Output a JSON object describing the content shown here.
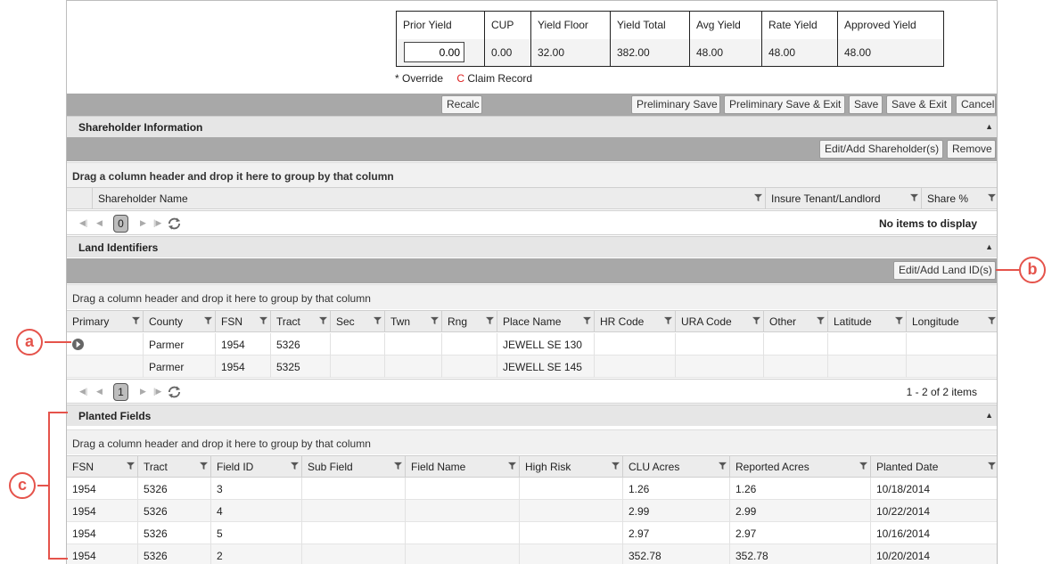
{
  "yield_table": {
    "headers": [
      "Prior Yield",
      "CUP",
      "Yield Floor",
      "Yield Total",
      "Avg Yield",
      "Rate Yield",
      "Approved Yield"
    ],
    "prior_yield_value": "0.00",
    "values": [
      "0.00",
      "32.00",
      "382.00",
      "48.00",
      "48.00",
      "48.00"
    ]
  },
  "legend": {
    "override": "* Override",
    "claim_letter": "C",
    "claim_text": "Claim Record"
  },
  "toolbar": {
    "recalc": "Recalc",
    "preliminary_save": "Preliminary Save",
    "preliminary_save_exit": "Preliminary Save & Exit",
    "save": "Save",
    "save_exit": "Save & Exit",
    "cancel": "Cancel"
  },
  "shareholder": {
    "title": "Shareholder Information",
    "edit_button": "Edit/Add Shareholder(s)",
    "remove_button": "Remove",
    "group_hint": "Drag a column header and drop it here to group by that column",
    "columns": [
      "Shareholder Name",
      "Insure Tenant/Landlord",
      "Share %"
    ],
    "page": "0",
    "status": "No items to display"
  },
  "land": {
    "title": "Land Identifiers",
    "edit_button": "Edit/Add Land ID(s)",
    "group_hint": "Drag a column header and drop it here to group by that column",
    "columns": [
      "Primary",
      "County",
      "FSN",
      "Tract",
      "Sec",
      "Twn",
      "Rng",
      "Place Name",
      "HR Code",
      "URA Code",
      "Other",
      "Latitude",
      "Longitude"
    ],
    "rows": [
      [
        "",
        "Parmer",
        "1954",
        "5326",
        "",
        "",
        "",
        "JEWELL SE 130",
        "",
        "",
        "",
        "",
        ""
      ],
      [
        "",
        "Parmer",
        "1954",
        "5325",
        "",
        "",
        "",
        "JEWELL SE 145",
        "",
        "",
        "",
        "",
        ""
      ]
    ],
    "page": "1",
    "status": "1 - 2 of 2 items"
  },
  "planted": {
    "title": "Planted Fields",
    "group_hint": "Drag a column header and drop it here to group by that column",
    "columns": [
      "FSN",
      "Tract",
      "Field ID",
      "Sub Field",
      "Field Name",
      "High Risk",
      "CLU Acres",
      "Reported Acres",
      "Planted Date"
    ],
    "rows": [
      [
        "1954",
        "5326",
        "3",
        "",
        "",
        "",
        "1.26",
        "1.26",
        "10/18/2014"
      ],
      [
        "1954",
        "5326",
        "4",
        "",
        "",
        "",
        "2.99",
        "2.99",
        "10/22/2014"
      ],
      [
        "1954",
        "5326",
        "5",
        "",
        "",
        "",
        "2.97",
        "2.97",
        "10/16/2014"
      ],
      [
        "1954",
        "5326",
        "2",
        "",
        "",
        "",
        "352.78",
        "352.78",
        "10/20/2014"
      ]
    ]
  },
  "callouts": {
    "a": "a",
    "b": "b",
    "c": "c"
  },
  "colors": {
    "accent": "#e5534b",
    "bar": "#a8a8a8",
    "header": "#e6e6e6"
  }
}
